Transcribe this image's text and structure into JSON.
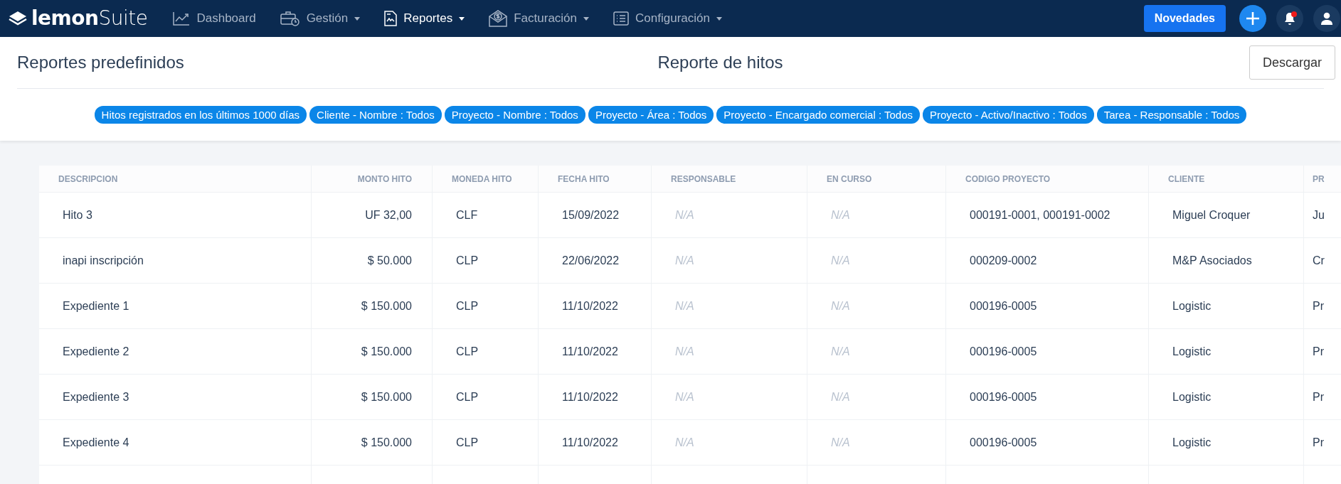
{
  "navbar": {
    "logo": "**lemon**Suite",
    "items": [
      {
        "label": "Dashboard",
        "selected": false,
        "dropdown": false
      },
      {
        "label": "Gestión",
        "selected": false,
        "dropdown": true
      },
      {
        "label": "Reportes",
        "selected": true,
        "dropdown": true
      },
      {
        "label": "Facturación",
        "selected": false,
        "dropdown": true
      },
      {
        "label": "Configuración",
        "selected": false,
        "dropdown": true
      }
    ],
    "news_button": "Novedades",
    "notifications_unread": true
  },
  "header": {
    "left_title": "Reportes predefinidos",
    "title": "Reporte de hitos",
    "download_button": "Descargar"
  },
  "filters": [
    "Hitos registrados en los últimos 1000 días",
    "Cliente - Nombre : Todos",
    "Proyecto - Nombre : Todos",
    "Proyecto - Área : Todos",
    "Proyecto - Encargado comercial : Todos",
    "Proyecto - Activo/Inactivo : Todos",
    "Tarea - Responsable : Todos"
  ],
  "table": {
    "columns": [
      {
        "label": "DESCRIPCION",
        "kind": "text"
      },
      {
        "label": "MONTO HITO",
        "kind": "amount"
      },
      {
        "label": "MONEDA HITO",
        "kind": "text"
      },
      {
        "label": "FECHA HITO",
        "kind": "text"
      },
      {
        "label": "RESPONSABLE",
        "kind": "missing"
      },
      {
        "label": "EN CURSO",
        "kind": "missing"
      },
      {
        "label": "CODIGO PROYECTO",
        "kind": "text"
      },
      {
        "label": "CLIENTE",
        "kind": "text"
      },
      {
        "label": "PR",
        "kind": "text"
      }
    ],
    "rows": [
      [
        "Hito 3",
        "UF 32,00",
        "CLF",
        "15/09/2022",
        "N/A",
        "N/A",
        "000191-0001, 000191-0002",
        "Miguel Croquer",
        "Ju"
      ],
      [
        "inapi inscripción",
        "$ 50.000",
        "CLP",
        "22/06/2022",
        "N/A",
        "N/A",
        "000209-0002",
        "M&P Asociados",
        "Cr"
      ],
      [
        "Expediente 1",
        "$ 150.000",
        "CLP",
        "11/10/2022",
        "N/A",
        "N/A",
        "000196-0005",
        "Logistic",
        "Pr"
      ],
      [
        "Expediente 2",
        "$ 150.000",
        "CLP",
        "11/10/2022",
        "N/A",
        "N/A",
        "000196-0005",
        "Logistic",
        "Pr"
      ],
      [
        "Expediente 3",
        "$ 150.000",
        "CLP",
        "11/10/2022",
        "N/A",
        "N/A",
        "000196-0005",
        "Logistic",
        "Pr"
      ],
      [
        "Expediente 4",
        "$ 150.000",
        "CLP",
        "11/10/2022",
        "N/A",
        "N/A",
        "000196-0005",
        "Logistic",
        "Pr"
      ]
    ]
  }
}
